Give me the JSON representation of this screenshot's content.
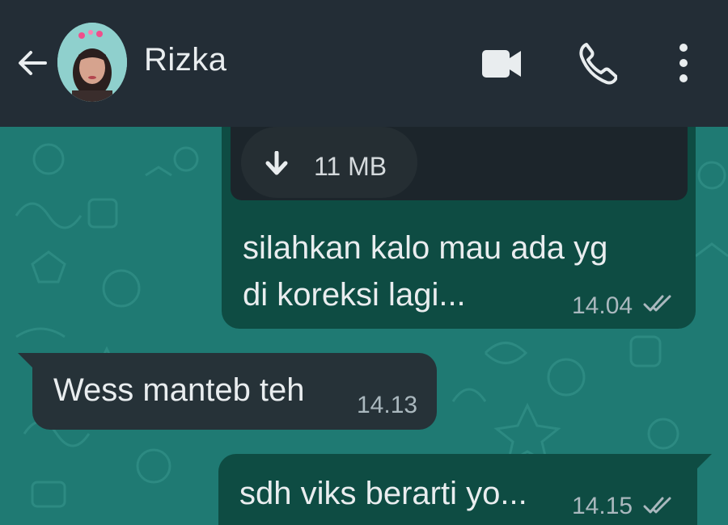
{
  "header": {
    "contact_name": "Rizka",
    "icons": [
      "back-arrow-icon",
      "avatar",
      "video-call-icon",
      "phone-icon",
      "more-vert-icon"
    ]
  },
  "messages": [
    {
      "direction": "outgoing",
      "attachment_size": "11 MB",
      "text_line1": "silahkan kalo mau ada yg",
      "text_line2": "di koreksi lagi...",
      "time": "14.04",
      "status": "read"
    },
    {
      "direction": "incoming",
      "text": "Wess manteb teh",
      "time": "14.13"
    },
    {
      "direction": "outgoing",
      "text": "sdh viks berarti yo...",
      "time": "14.15",
      "status": "read"
    }
  ],
  "colors": {
    "header_bg": "#232d36",
    "wallpaper": "#1f7a73",
    "outgoing_bubble": "#0e4c43",
    "incoming_bubble": "#263238"
  }
}
